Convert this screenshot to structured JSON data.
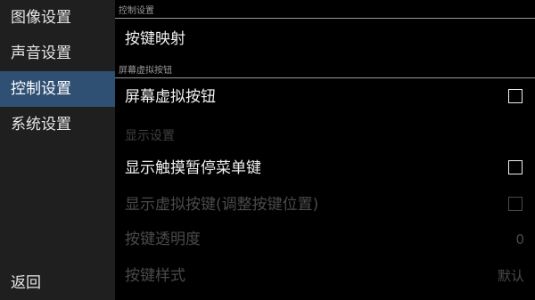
{
  "sidebar": {
    "items": [
      {
        "label": "图像设置"
      },
      {
        "label": "声音设置"
      },
      {
        "label": "控制设置",
        "selected": true
      },
      {
        "label": "系统设置"
      }
    ],
    "back_label": "返回"
  },
  "main": {
    "section1_header": "控制设置",
    "row_keymap": "按键映射",
    "section2_header": "屏幕虚拟按钮",
    "row_virtual_buttons": "屏幕虚拟按钮",
    "section3_header": "显示设置",
    "row_touch_pause": "显示触摸暂停菜单键",
    "row_dim1": "显示虚拟按键(调整按键位置)",
    "row_dim2": "按键透明度",
    "row_dim2_value": "0",
    "row_dim3": "按键样式",
    "row_dim3_value": "默认"
  },
  "colors": {
    "selected_bg": "#2f4f73",
    "sidebar_bg": "#1f1f1f",
    "main_bg": "#000000"
  }
}
